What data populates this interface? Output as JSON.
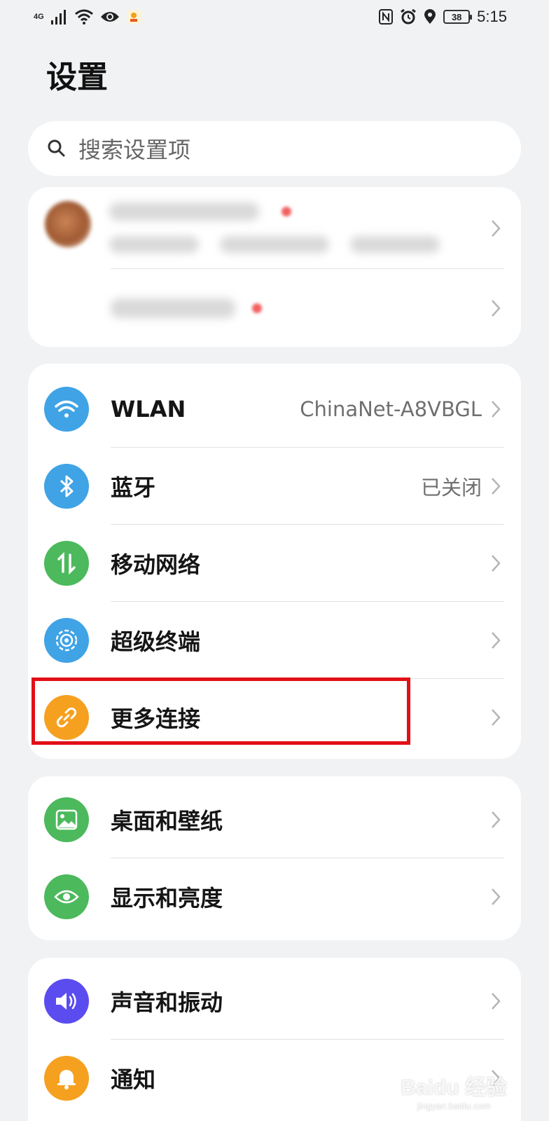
{
  "status_bar": {
    "network": "4G",
    "battery": "38",
    "time": "5:15"
  },
  "page": {
    "title": "设置"
  },
  "search": {
    "placeholder": "搜索设置项"
  },
  "connectivity": {
    "items": [
      {
        "label": "WLAN",
        "value": "ChinaNet-A8VBGL",
        "icon": "wifi-icon",
        "color": "#3fa3e6"
      },
      {
        "label": "蓝牙",
        "value": "已关闭",
        "icon": "bluetooth-icon",
        "color": "#3fa3e6"
      },
      {
        "label": "移动网络",
        "value": "",
        "icon": "mobile-data-icon",
        "color": "#4cb95c"
      },
      {
        "label": "超级终端",
        "value": "",
        "icon": "super-device-icon",
        "color": "#3fa3e6"
      },
      {
        "label": "更多连接",
        "value": "",
        "icon": "link-icon",
        "color": "#f6a020"
      }
    ]
  },
  "display": {
    "items": [
      {
        "label": "桌面和壁纸",
        "icon": "wallpaper-icon",
        "color": "#4cb95c"
      },
      {
        "label": "显示和亮度",
        "icon": "eye-icon",
        "color": "#4cb95c"
      }
    ]
  },
  "sound": {
    "items": [
      {
        "label": "声音和振动",
        "icon": "volume-icon",
        "color": "#5b4cf0"
      },
      {
        "label": "通知",
        "icon": "bell-icon",
        "color": "#f6a020"
      }
    ]
  },
  "watermark": {
    "text": "Baidu 经验",
    "sub": "jingyan.baidu.com"
  }
}
